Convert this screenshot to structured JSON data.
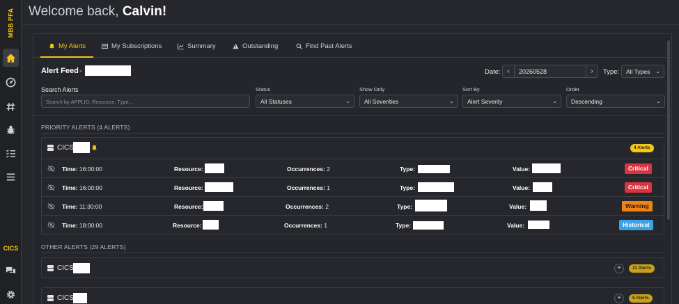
{
  "brand": "MBB PFA",
  "sidebar": {
    "items": [
      {
        "icon": "home-icon",
        "active": true
      },
      {
        "icon": "dashboard-gauge-icon",
        "active": false
      },
      {
        "icon": "hash-icon",
        "active": false
      },
      {
        "icon": "bug-icon",
        "active": false
      },
      {
        "icon": "checklist-icon",
        "active": false
      },
      {
        "icon": "menu-icon",
        "active": false
      }
    ],
    "cics_label": "CICS",
    "bottom_items": [
      {
        "icon": "chat-icon"
      },
      {
        "icon": "settings-gear-icon"
      }
    ]
  },
  "header": {
    "welcome_prefix": "Welcome back,",
    "user_name": "Calvin!"
  },
  "tabs": [
    {
      "label": "My Alerts",
      "icon": "bell-icon",
      "active": true
    },
    {
      "label": "My Subscriptions",
      "icon": "list-icon",
      "active": false
    },
    {
      "label": "Summary",
      "icon": "chart-icon",
      "active": false
    },
    {
      "label": "Outstanding",
      "icon": "warning-icon",
      "active": false
    },
    {
      "label": "Find Past Alerts",
      "icon": "search-icon",
      "active": false
    }
  ],
  "feed": {
    "title": "Alert Feed",
    "dash": "-",
    "date_label": "Date:",
    "date_value": "20260528",
    "type_label": "Type:",
    "type_value": "All Types"
  },
  "filters": {
    "search_label": "Search Alerts",
    "search_placeholder": "Search by APPLID, Resource, Type...",
    "status_label": "Status",
    "status_value": "All Statuses",
    "show_only_label": "Show Only",
    "show_only_value": "All Severities",
    "sort_by_label": "Sort By",
    "sort_by_value": "Alert Severity",
    "order_label": "Order",
    "order_value": "Descending"
  },
  "priority": {
    "title": "PRIORITY ALERTS (4 ALERTS)",
    "group_name": "CICS",
    "count_badge": "4 Alerts",
    "rows": [
      {
        "time_label": "Time:",
        "time": "16:00:00",
        "resource_label": "Resource:",
        "occ_label": "Occurrences:",
        "occurrences": "2",
        "type_label": "Type:",
        "value_label": "Value:",
        "severity": "Critical",
        "sev_class": "critical"
      },
      {
        "time_label": "Time:",
        "time": "16:00:00",
        "resource_label": "Resource:",
        "occ_label": "Occurrences:",
        "occurrences": "1",
        "type_label": "Type:",
        "value_label": "Value:",
        "severity": "Critical",
        "sev_class": "critical"
      },
      {
        "time_label": "Time:",
        "time": "11:30:00",
        "resource_label": "Resource:",
        "occ_label": "Occurrences:",
        "occurrences": "2",
        "type_label": "Type:",
        "value_label": "Value:",
        "severity": "Warning",
        "sev_class": "warning"
      },
      {
        "time_label": "Time:",
        "time": "18:00:00",
        "resource_label": "Resource:",
        "occ_label": "Occurrences:",
        "occurrences": "1",
        "type_label": "Type:",
        "value_label": "Value:",
        "severity": "Historical",
        "sev_class": "historical"
      }
    ]
  },
  "other": {
    "title": "OTHER ALERTS (29 ALERTS)",
    "groups": [
      {
        "name": "CICS",
        "count_badge": "11 Alerts"
      },
      {
        "name": "CICS",
        "count_badge": "5 Alerts"
      }
    ]
  },
  "colors": {
    "accent": "#f5c518",
    "critical": "#d9343f",
    "warning": "#f0821a",
    "historical": "#3ba2e6",
    "background": "#25272c"
  }
}
